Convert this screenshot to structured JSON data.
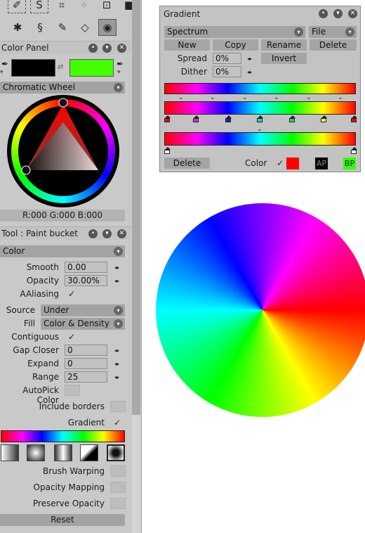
{
  "color_panel": {
    "title": "Color Panel",
    "main_color": "#000000",
    "sub_color": "#44ff00",
    "mode": "Chromatic Wheel",
    "rgb_readout": "R:000 G:000 B:000"
  },
  "tool_panel": {
    "title": "Tool : Paint bucket",
    "category": "Color",
    "smooth": {
      "label": "Smooth",
      "value": "0.00"
    },
    "opacity": {
      "label": "Opacity",
      "value": "30.00%"
    },
    "aaliasing": {
      "label": "AAliasing"
    },
    "source": {
      "label": "Source",
      "value": "Under"
    },
    "fill": {
      "label": "Fill",
      "value": "Color & Density"
    },
    "contiguous": {
      "label": "Contiguous"
    },
    "gap_closer": {
      "label": "Gap Closer",
      "value": "0"
    },
    "expand": {
      "label": "Expand",
      "value": "0"
    },
    "range": {
      "label": "Range",
      "value": "25"
    },
    "autopick_color": {
      "label": "AutoPick Color"
    },
    "include_borders": {
      "label": "Include borders"
    },
    "gradient": {
      "label": "Gradient"
    },
    "brush_warping": {
      "label": "Brush Warping"
    },
    "opacity_mapping": {
      "label": "Opacity Mapping"
    },
    "preserve_opacity": {
      "label": "Preserve Opacity"
    },
    "reset_label": "Reset"
  },
  "gradient_window": {
    "title": "Gradient",
    "preset": "Spectrum",
    "file_menu": "File",
    "new_label": "New",
    "copy_label": "Copy",
    "rename_label": "Rename",
    "delete_label": "Delete",
    "spread": {
      "label": "Spread",
      "value": "0%"
    },
    "invert_label": "Invert",
    "dither": {
      "label": "Dither",
      "value": "0%"
    },
    "bottom_delete_label": "Delete",
    "color_label": "Color",
    "color_value": "#ff0000",
    "ap_label": "AP",
    "bp_label": "BP",
    "ap_color": "#000000",
    "bp_color": "#33ff00"
  }
}
